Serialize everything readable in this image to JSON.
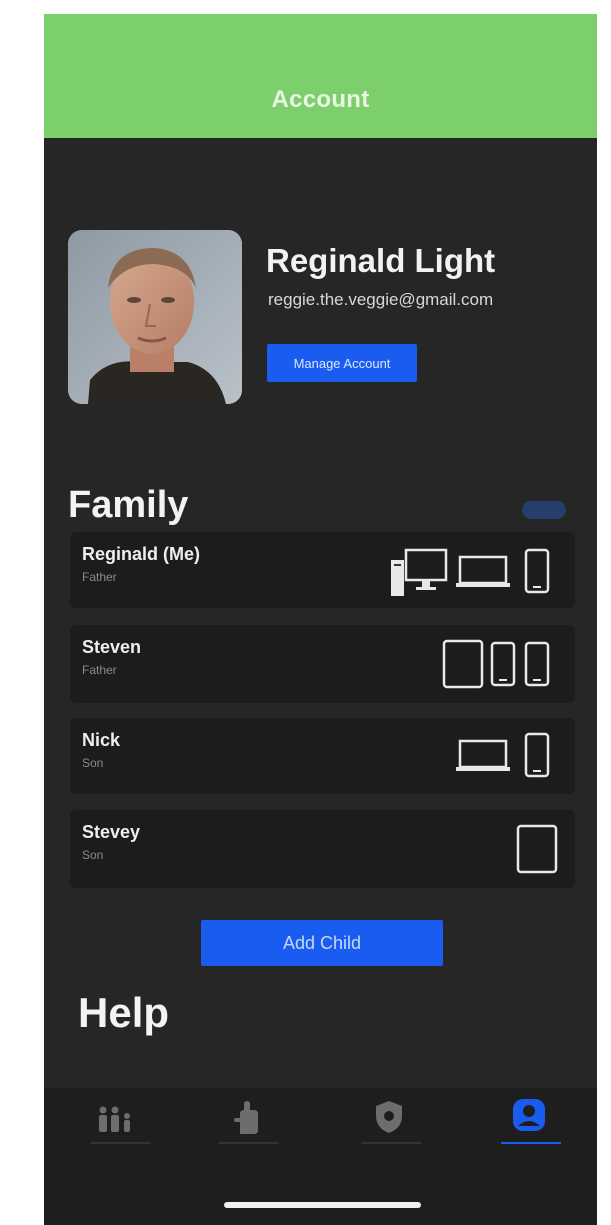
{
  "header": {
    "title": "Account"
  },
  "profile": {
    "name": "Reginald Light",
    "email": "reggie.the.veggie@gmail.com",
    "manage_label": "Manage Account"
  },
  "family": {
    "title": "Family",
    "members": [
      {
        "name": "Reginald (Me)",
        "role": "Father",
        "devices": [
          "desktop-icon",
          "laptop-icon",
          "phone-icon"
        ]
      },
      {
        "name": "Steven",
        "role": "Father",
        "devices": [
          "tablet-icon",
          "phone-icon",
          "phone-icon"
        ]
      },
      {
        "name": "Nick",
        "role": "Son",
        "devices": [
          "laptop-icon",
          "phone-icon"
        ]
      },
      {
        "name": "Stevey",
        "role": "Son",
        "devices": [
          "tablet-icon"
        ]
      }
    ],
    "add_child_label": "Add Child"
  },
  "help": {
    "title": "Help"
  },
  "tab_bar": {
    "tabs": [
      {
        "icon": "family-icon",
        "active": false
      },
      {
        "icon": "hand-icon",
        "active": false
      },
      {
        "icon": "shield-icon",
        "active": false
      },
      {
        "icon": "account-icon",
        "active": true
      }
    ]
  },
  "colors": {
    "header": "#7ccf6a",
    "background": "#262626",
    "card": "#1c1c1c",
    "accent_blue": "#1a5cf0"
  }
}
